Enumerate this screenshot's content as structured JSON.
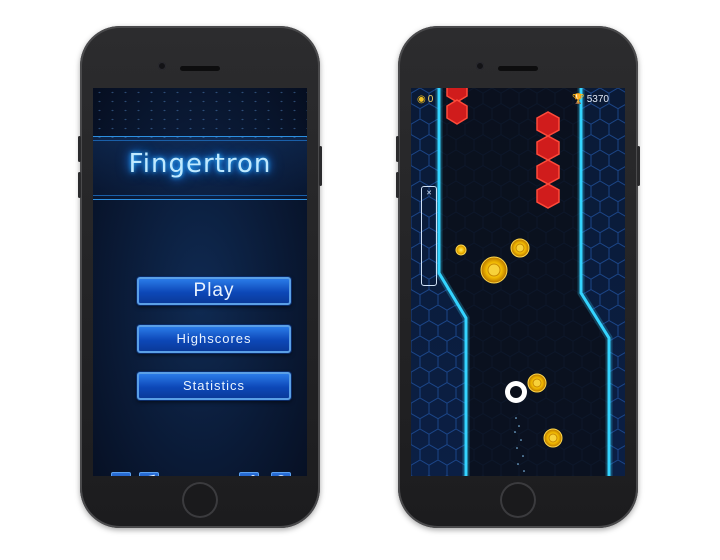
{
  "menu": {
    "title": "Fingertron",
    "play_label": "Play",
    "highscores_label": "Highscores",
    "statistics_label": "Statistics",
    "sound_icon": "speaker-icon",
    "music_icon": "music-note-icon",
    "share_icon": "share-icon",
    "help_icon": "question-icon"
  },
  "game": {
    "coins": "0",
    "score": "5370",
    "coin_icon": "coin-icon",
    "score_icon": "trophy-icon"
  },
  "colors": {
    "neon_blue": "#35d4ff",
    "button_blue": "#1a5fd8",
    "hex_red": "#d01c1c",
    "coin_yellow": "#f2c020"
  }
}
